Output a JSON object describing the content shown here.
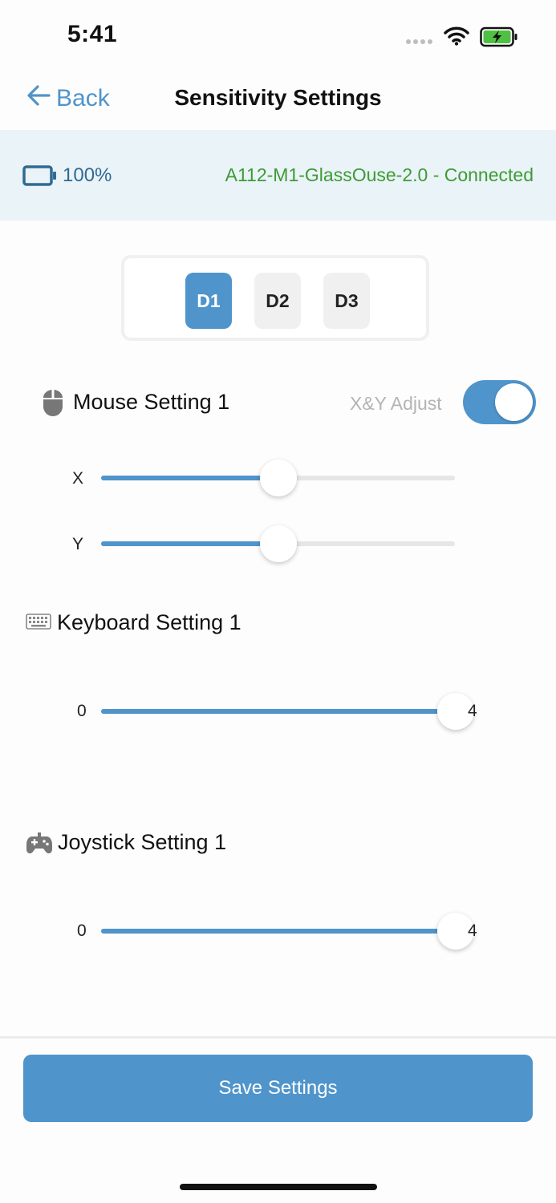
{
  "status_bar": {
    "time": "5:41"
  },
  "nav": {
    "back_label": "Back",
    "title": "Sensitivity Settings"
  },
  "device": {
    "battery": "100%",
    "status": "A112-M1-GlassOuse-2.0 - Connected"
  },
  "segments": [
    {
      "label": "D1",
      "selected": true
    },
    {
      "label": "D2",
      "selected": false
    },
    {
      "label": "D3",
      "selected": false
    }
  ],
  "mouse": {
    "title": "Mouse Setting 1",
    "xy_adjust_label": "X&Y Adjust",
    "xy_adjust_on": true,
    "x_label": "X",
    "y_label": "Y",
    "x_value": 0.5,
    "y_value": 0.5
  },
  "keyboard": {
    "title": "Keyboard Setting 1",
    "min": "0",
    "max": "4",
    "value": 4
  },
  "joystick": {
    "title": "Joystick Setting 1",
    "min": "0",
    "max": "4",
    "value": 4
  },
  "footer": {
    "save_label": "Save Settings"
  },
  "colors": {
    "accent": "#4f94cb",
    "connected": "#3d9b35",
    "banner_bg": "#eaf3f7"
  },
  "icons": [
    "back-arrow-icon",
    "battery-icon",
    "mouse-icon",
    "keyboard-icon",
    "gamepad-icon"
  ]
}
